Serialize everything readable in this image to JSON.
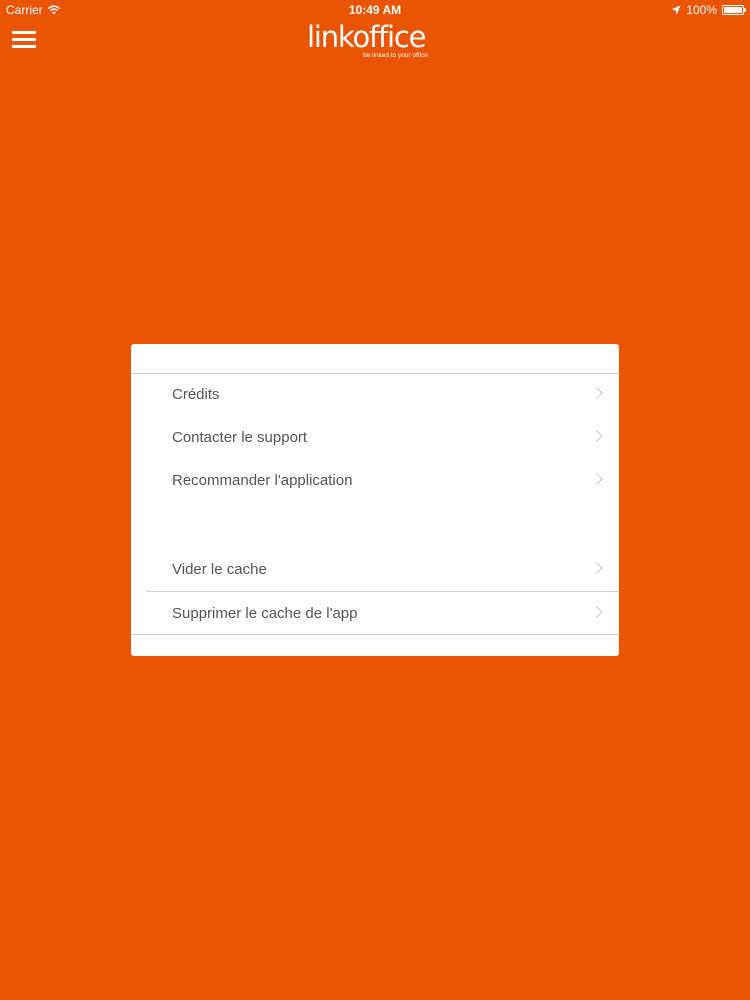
{
  "status_bar": {
    "carrier": "Carrier",
    "time": "10:49 AM",
    "battery_percent": "100%",
    "battery_level": 1.0,
    "icons": [
      "wifi-icon",
      "location-arrow-icon",
      "battery-icon"
    ]
  },
  "nav": {
    "menu_icon": "hamburger-icon",
    "logo_text": "linkoffice",
    "logo_tagline": "be linked to your office"
  },
  "menu": {
    "group1": [
      {
        "label": "Crédits"
      },
      {
        "label": "Contacter le support"
      },
      {
        "label": "Recommander l'application"
      }
    ],
    "group2": [
      {
        "label": "Vider le cache"
      },
      {
        "label": "Supprimer le cache de l'app"
      }
    ]
  },
  "colors": {
    "background": "#EA5503",
    "card": "#FFFFFF",
    "text": "#555555",
    "separator": "#CFCFCF",
    "chevron": "#C4C4C7"
  }
}
